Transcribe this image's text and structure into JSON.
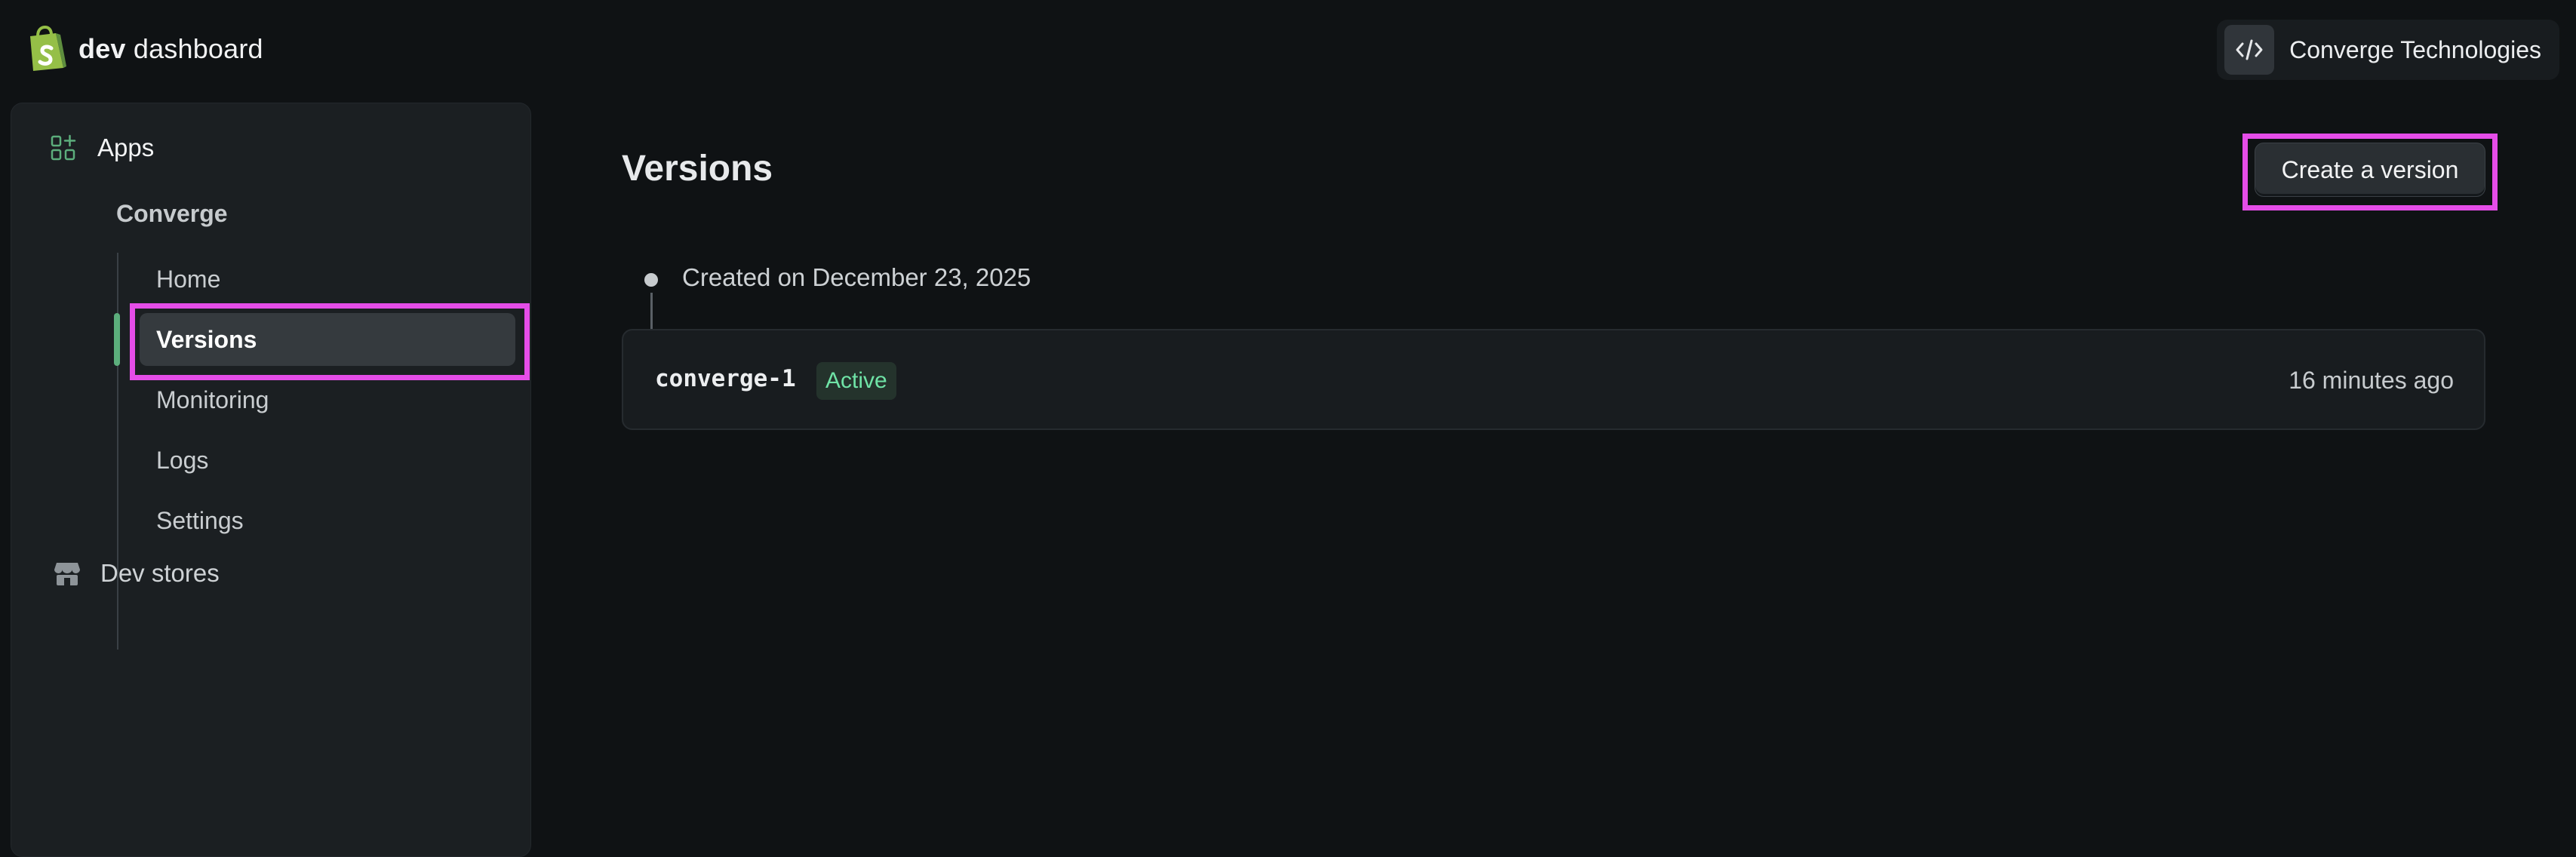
{
  "header": {
    "brand_bold": "dev",
    "brand_rest": "dashboard",
    "org_name": "Converge Technologies"
  },
  "sidebar": {
    "apps_label": "Apps",
    "app_name": "Converge",
    "items": [
      {
        "label": "Home"
      },
      {
        "label": "Versions",
        "active": true
      },
      {
        "label": "Monitoring"
      },
      {
        "label": "Logs"
      },
      {
        "label": "Settings"
      }
    ],
    "dev_stores_label": "Dev stores"
  },
  "main": {
    "title": "Versions",
    "create_button_label": "Create a version",
    "timeline_date": "Created on December 23, 2025",
    "versions": [
      {
        "name": "converge-1",
        "status": "Active",
        "time": "16 minutes ago"
      }
    ]
  },
  "colors": {
    "background": "#0f1214",
    "sidebar": "#1b1f22",
    "accent_green": "#5cae7c",
    "status_active": "#6fe3a6",
    "highlight": "#e54de8",
    "brand_green": "#95bf47"
  },
  "icons": {
    "brand": "shopify-bag-icon",
    "org": "code-icon",
    "apps": "apps-grid-icon",
    "dev_stores": "store-icon"
  }
}
